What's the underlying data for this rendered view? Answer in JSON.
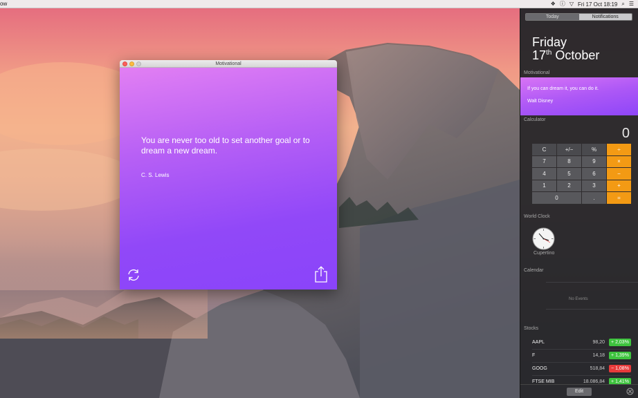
{
  "menubar": {
    "app_fragment": "ow",
    "clock": "Fri 17 Oct  18:19"
  },
  "window": {
    "title": "Motivational",
    "quote": "You are never too old to set another goal or to dream a new dream.",
    "author": "C. S. Lewis"
  },
  "notification_center": {
    "tabs": {
      "today": "Today",
      "notifications": "Notifications"
    },
    "day": "Friday",
    "date_num": "17",
    "date_suffix": "th",
    "date_month": "October",
    "motivational": {
      "title": "Motivational",
      "quote": "If you can dream it, you can do it.",
      "author": "Walt Disney"
    },
    "calculator": {
      "title": "Calculator",
      "display": "0",
      "keys": [
        [
          "C",
          "+/−",
          "%",
          "÷"
        ],
        [
          "7",
          "8",
          "9",
          "×"
        ],
        [
          "4",
          "5",
          "6",
          "−"
        ],
        [
          "1",
          "2",
          "3",
          "+"
        ],
        [
          "0",
          ".",
          "="
        ]
      ]
    },
    "world_clock": {
      "title": "World Clock",
      "city": "Cupertino"
    },
    "calendar": {
      "title": "Calendar",
      "empty": "No Events"
    },
    "stocks": {
      "title": "Stocks",
      "rows": [
        {
          "symbol": "AAPL",
          "price": "98,20",
          "change": "+ 2,03%",
          "dir": "up"
        },
        {
          "symbol": "F",
          "price": "14,18",
          "change": "+ 1,39%",
          "dir": "up"
        },
        {
          "symbol": "GOOG",
          "price": "518,84",
          "change": "− 1,08%",
          "dir": "down"
        },
        {
          "symbol": "FTSE MIB",
          "price": "18.086,84",
          "change": "+ 1,41%",
          "dir": "up"
        }
      ]
    },
    "footer": {
      "edit": "Edit"
    }
  },
  "colors": {
    "window_purple": "#9148f8",
    "calc_orange": "#f39a14",
    "stock_up": "#3ec33e",
    "stock_down": "#e83a3a"
  }
}
